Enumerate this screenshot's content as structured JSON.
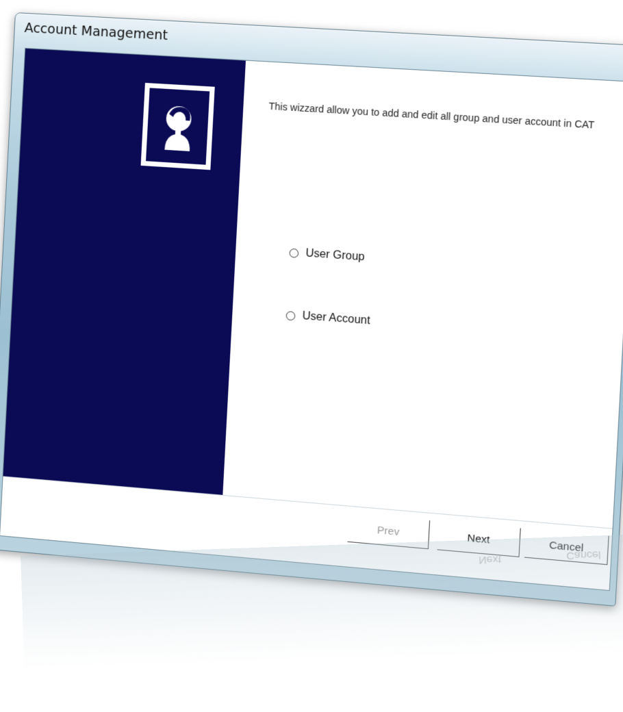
{
  "window": {
    "title": "Account Management",
    "close_label": "✕"
  },
  "wizard": {
    "intro": "This wizzard allow you to add and edit all group and user account in CAT",
    "options": [
      {
        "label": "User Group",
        "selected": false
      },
      {
        "label": "User Account",
        "selected": false
      }
    ]
  },
  "buttons": {
    "prev": "Prev",
    "next": "Next",
    "cancel": "Cancel"
  },
  "colors": {
    "side_panel": "#0b0a55",
    "close_button": "#d24a34"
  }
}
